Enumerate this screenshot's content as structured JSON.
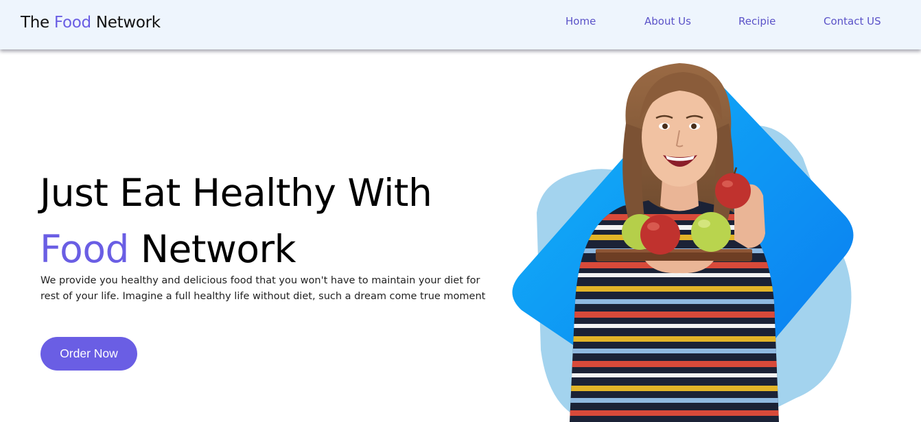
{
  "brand": {
    "prefix": "The ",
    "highlight": "Food",
    "suffix": " Network"
  },
  "nav": {
    "home": "Home",
    "about": "About Us",
    "recipe": "Recipie",
    "contact": "Contact US"
  },
  "hero": {
    "title_line1": "Just Eat Healthy With",
    "title_highlight": "Food",
    "title_line2_rest": " Network",
    "description": "We provide you healthy and delicious food that you won't have to maintain your diet for rest of your life. Imagine a full healthy life without diet, such a dream come true moment",
    "cta_label": "Order Now"
  },
  "colors": {
    "accent": "#6a5ee4",
    "nav_bg": "#eef5fd",
    "shape_light": "#a3d3ee",
    "shape_blue": "#1e90f5"
  }
}
